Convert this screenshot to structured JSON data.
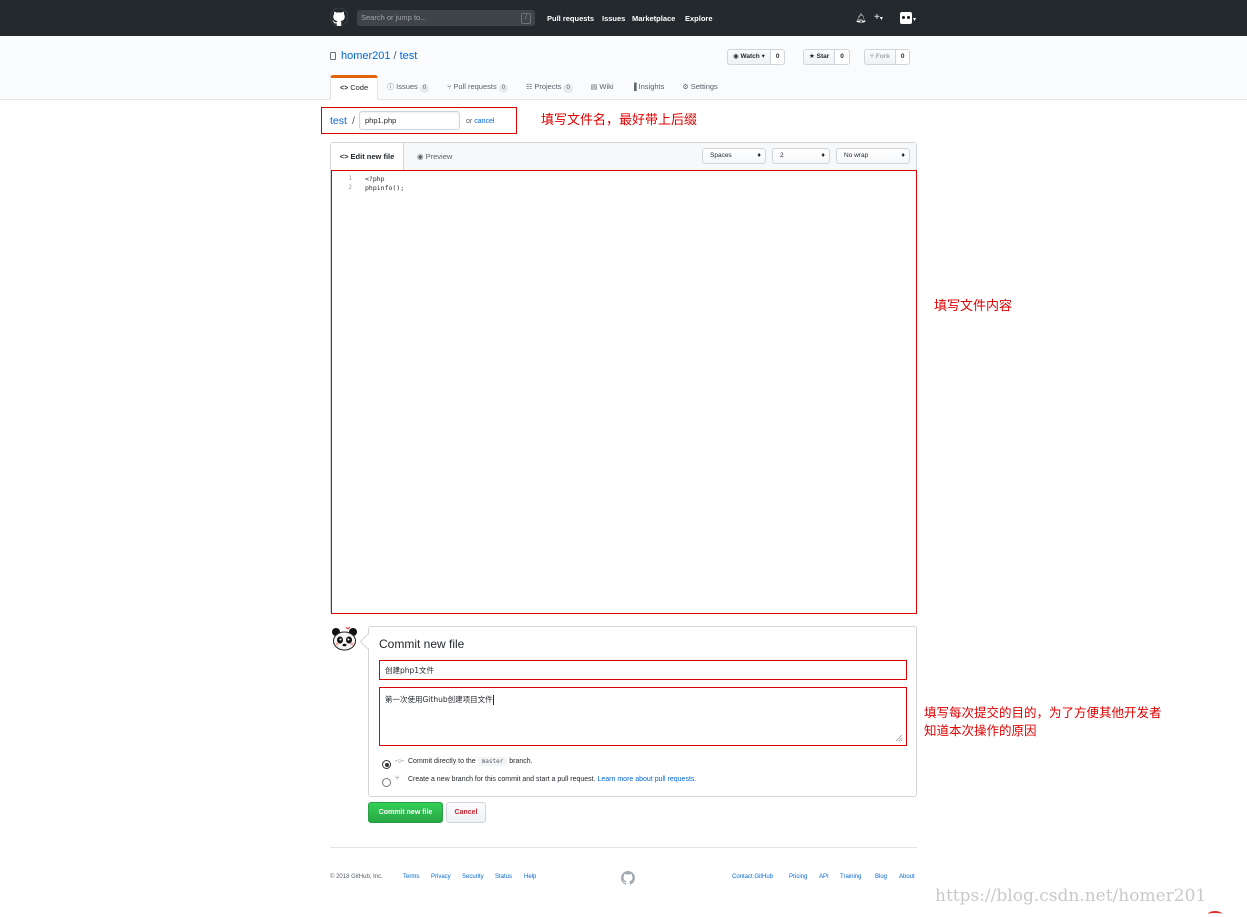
{
  "header": {
    "search_placeholder": "Search or jump to...",
    "search_shortcut": "/",
    "nav": [
      "Pull requests",
      "Issues",
      "Marketplace",
      "Explore"
    ],
    "plus_label": "+",
    "caret": "▾"
  },
  "repo": {
    "owner": "homer201",
    "separator": "/",
    "name": "test",
    "watch_label": "Watch",
    "watch_count": "0",
    "star_label": "Star",
    "star_count": "0",
    "fork_label": "Fork",
    "fork_count": "0"
  },
  "tabs": [
    {
      "label": "Code",
      "icon": "<>"
    },
    {
      "label": "Issues",
      "count": "0"
    },
    {
      "label": "Pull requests",
      "count": "0"
    },
    {
      "label": "Projects",
      "count": "0"
    },
    {
      "label": "Wiki"
    },
    {
      "label": "Insights"
    },
    {
      "label": "Settings"
    }
  ],
  "breadcrumb": {
    "repo": "test",
    "slash": "/",
    "filename": "php1.php",
    "or": "or",
    "cancel": "cancel"
  },
  "editor": {
    "tab_edit": "Edit new file",
    "tab_preview": "Preview",
    "indent_mode": "Spaces",
    "indent_size": "2",
    "wrap_mode": "No wrap",
    "lines": [
      {
        "num": "1",
        "text": "<?php"
      },
      {
        "num": "2",
        "text": "phpinfo();"
      }
    ]
  },
  "commit": {
    "title": "Commit new file",
    "message": "创建php1文件",
    "description": "第一次使用Github创建项目文件",
    "option_direct_prefix": "Commit directly to the",
    "option_direct_branch": "master",
    "option_direct_suffix": "branch.",
    "option_new": "Create a new branch for this commit and start a pull request.",
    "option_new_link": "Learn more about pull requests.",
    "submit_label": "Commit new file",
    "cancel_label": "Cancel"
  },
  "annotations": {
    "filename_note": "填写文件名，最好带上后缀",
    "content_note": "填写文件内容",
    "commit_note_line1": "填写每次提交的目的，为了方便其他开发者",
    "commit_note_line2": "知道本次操作的原因"
  },
  "footer": {
    "copyright": "© 2018 GitHub, Inc.",
    "left_links": [
      "Terms",
      "Privacy",
      "Security",
      "Status",
      "Help"
    ],
    "right_links": [
      "Contact GitHub",
      "Pricing",
      "API",
      "Training",
      "Blog",
      "About"
    ]
  },
  "watermark": "https://blog.csdn.net/homer201",
  "colors": {
    "annotation_red": "#e00000",
    "header_bg": "#24292e",
    "link_blue": "#0366d6",
    "commit_green": "#28a745"
  }
}
